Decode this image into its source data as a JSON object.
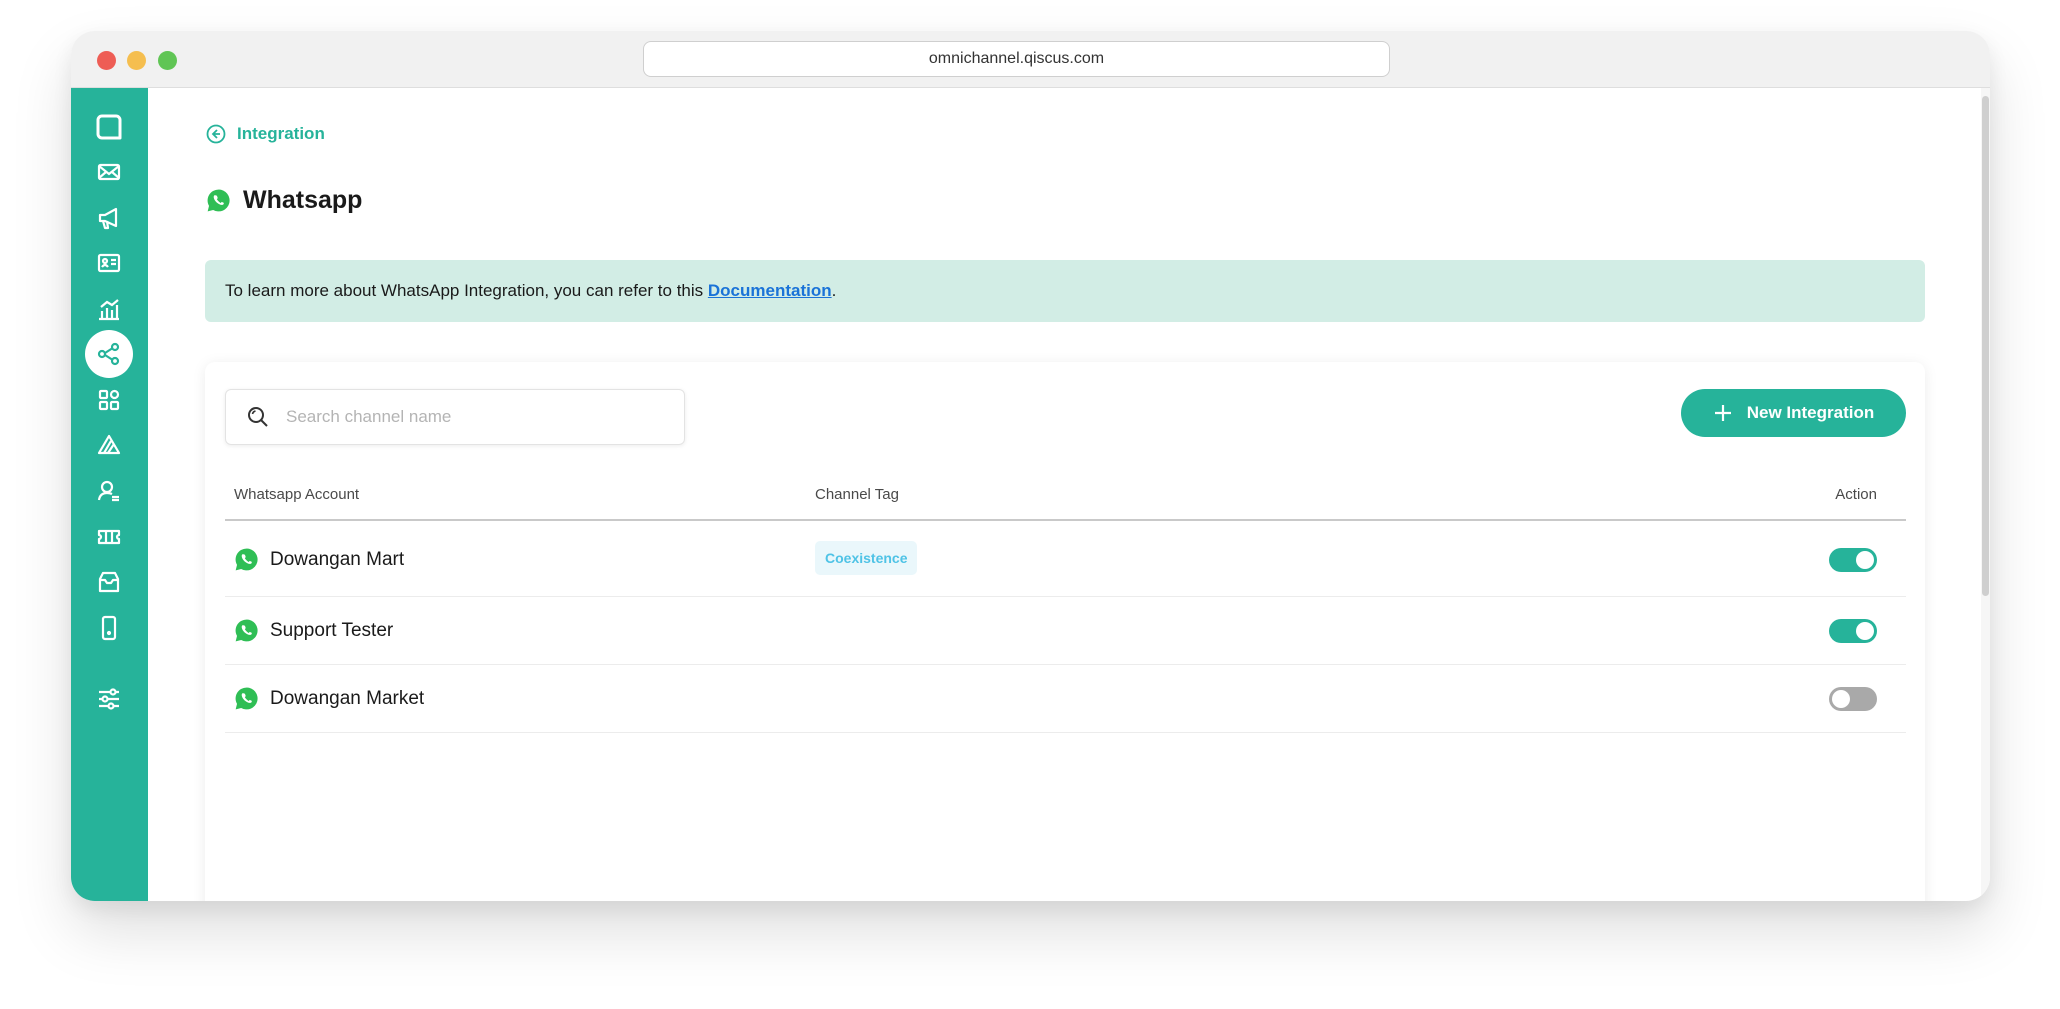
{
  "browser": {
    "url": "omnichannel.qiscus.com"
  },
  "sidebar": {
    "items": [
      {
        "icon": "chat-bubble-icon",
        "active": false
      },
      {
        "icon": "mail-icon",
        "active": false
      },
      {
        "icon": "megaphone-icon",
        "active": false
      },
      {
        "icon": "contact-card-icon",
        "active": false
      },
      {
        "icon": "analytics-icon",
        "active": false
      },
      {
        "icon": "integration-icon",
        "active": true
      },
      {
        "icon": "apps-grid-icon",
        "active": false
      },
      {
        "icon": "bot-icon",
        "active": false
      },
      {
        "icon": "agent-icon",
        "active": false
      },
      {
        "icon": "ticket-icon",
        "active": false
      },
      {
        "icon": "inbox-icon",
        "active": false
      },
      {
        "icon": "mobile-icon",
        "active": false
      },
      {
        "icon": "settings-sliders-icon",
        "active": false
      }
    ]
  },
  "header": {
    "back_label": "Integration",
    "title": "Whatsapp"
  },
  "banner": {
    "text_before": "To learn more about WhatsApp Integration, you can refer to this ",
    "link_label": "Documentation",
    "text_after": "."
  },
  "search": {
    "placeholder": "Search channel name"
  },
  "actions": {
    "new_integration_label": "New Integration"
  },
  "table": {
    "columns": [
      "Whatsapp Account",
      "Channel Tag",
      "Action"
    ],
    "rows": [
      {
        "name": "Dowangan Mart",
        "tag": "Coexistence",
        "enabled": true
      },
      {
        "name": "Support Tester",
        "tag": "",
        "enabled": true
      },
      {
        "name": "Dowangan Market",
        "tag": "",
        "enabled": false
      }
    ]
  },
  "colors": {
    "brand": "#26b39a",
    "banner_bg": "#d2ede5",
    "link": "#1a73d8",
    "tag_text": "#4fc3e6",
    "whatsapp": "#2fbe55"
  }
}
